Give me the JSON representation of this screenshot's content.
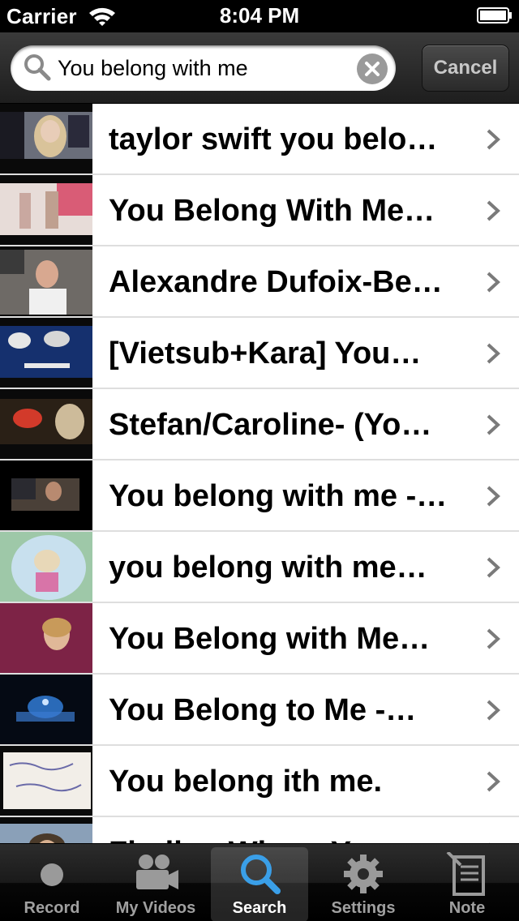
{
  "status_bar": {
    "carrier": "Carrier",
    "time": "8:04 PM"
  },
  "search": {
    "query": "You belong with me",
    "cancel_label": "Cancel"
  },
  "results": [
    {
      "title": "taylor swift you belo…"
    },
    {
      "title": "You Belong With Me…"
    },
    {
      "title": "Alexandre Dufoix-Be…"
    },
    {
      "title": "[Vietsub+Kara] You…"
    },
    {
      "title": "Stefan/Caroline- (Yo…"
    },
    {
      "title": "You belong with me -…"
    },
    {
      "title": "you belong with me…"
    },
    {
      "title": "You Belong with Me…"
    },
    {
      "title": "You Belong to Me -…"
    },
    {
      "title": "You belong ith me."
    },
    {
      "title": "Finding Where Yo…"
    }
  ],
  "tab_bar": {
    "tabs": [
      {
        "label": "Record",
        "icon": "record-icon"
      },
      {
        "label": "My Videos",
        "icon": "video-camera-icon"
      },
      {
        "label": "Search",
        "icon": "search-icon",
        "active": true
      },
      {
        "label": "Settings",
        "icon": "gear-icon"
      },
      {
        "label": "Note",
        "icon": "note-icon"
      }
    ]
  },
  "colors": {
    "accent": "#3a9fe8",
    "bar_dark": "#1e1e1e",
    "separator": "#dedede"
  }
}
